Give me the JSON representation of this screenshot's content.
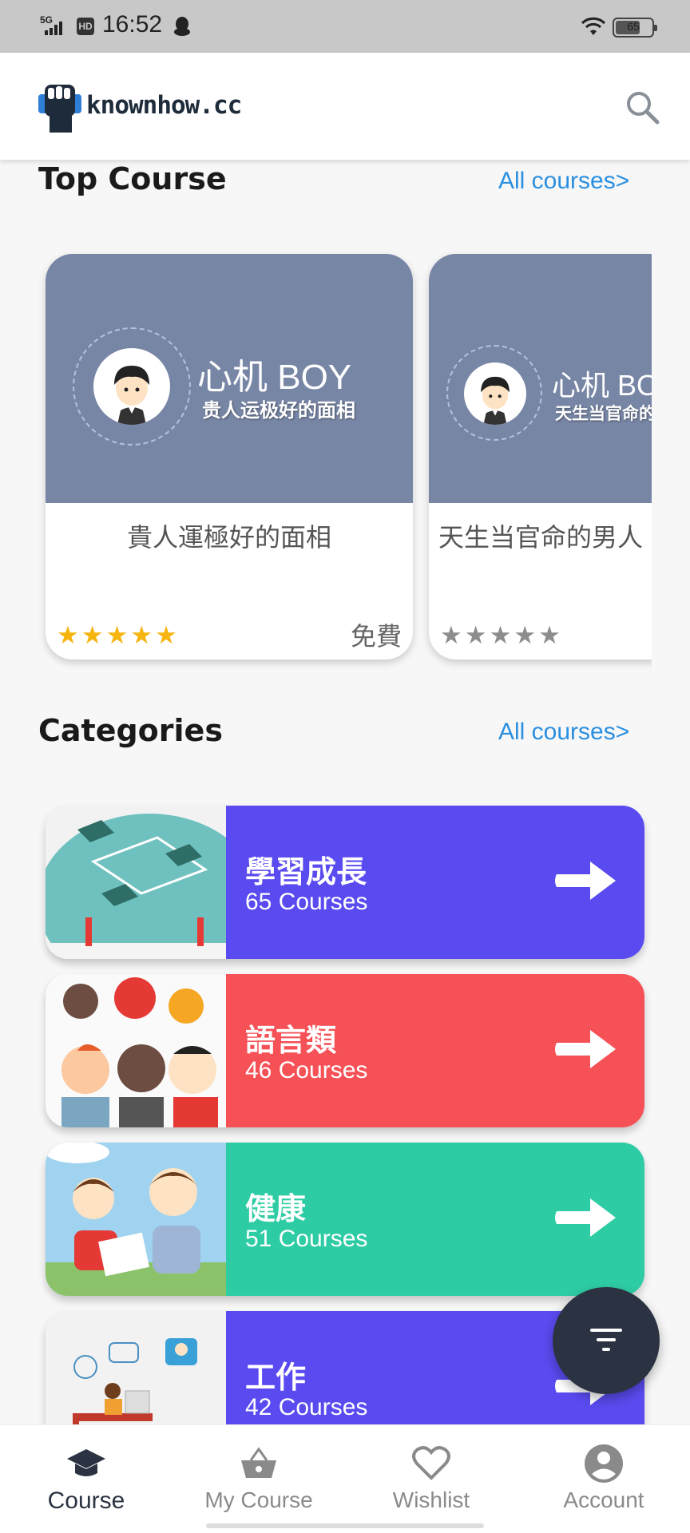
{
  "status_bar": {
    "network": "5G",
    "hd": "HD",
    "time": "16:52",
    "battery": "65"
  },
  "header": {
    "logo_text": "knownhow.cc"
  },
  "top_course": {
    "title": "Top Course",
    "link": "All courses>",
    "courses": [
      {
        "brand": "心机 BOY",
        "slogan": "贵人运极好的面相",
        "title": "貴人運極好的面相",
        "rating": 5,
        "rating_color": "#f6b40e",
        "price": "免費"
      },
      {
        "brand": "心机 BOY",
        "slogan": "天生当官命的",
        "title": "天生当官命的男人",
        "rating": 5,
        "rating_color": "#8d8d8d",
        "price": ""
      }
    ]
  },
  "categories": {
    "title": "Categories",
    "link": "All courses>",
    "items": [
      {
        "name": "學習成長",
        "count": "65 Courses",
        "color": "#5a4bf0"
      },
      {
        "name": "語言類",
        "count": "46 Courses",
        "color": "#f65157"
      },
      {
        "name": "健康",
        "count": "51 Courses",
        "color": "#2ecca4"
      },
      {
        "name": "工作",
        "count": "42 Courses",
        "color": "#5a4bf0"
      }
    ]
  },
  "bottom_nav": {
    "items": [
      {
        "label": "Course",
        "icon": "graduation-cap-icon",
        "active": true
      },
      {
        "label": "My Course",
        "icon": "basket-icon",
        "active": false
      },
      {
        "label": "Wishlist",
        "icon": "heart-icon",
        "active": false
      },
      {
        "label": "Account",
        "icon": "account-circle-icon",
        "active": false
      }
    ]
  },
  "colors": {
    "link": "#2a8fe0",
    "nav_active": "#2b3342",
    "fab": "#2b3342"
  }
}
